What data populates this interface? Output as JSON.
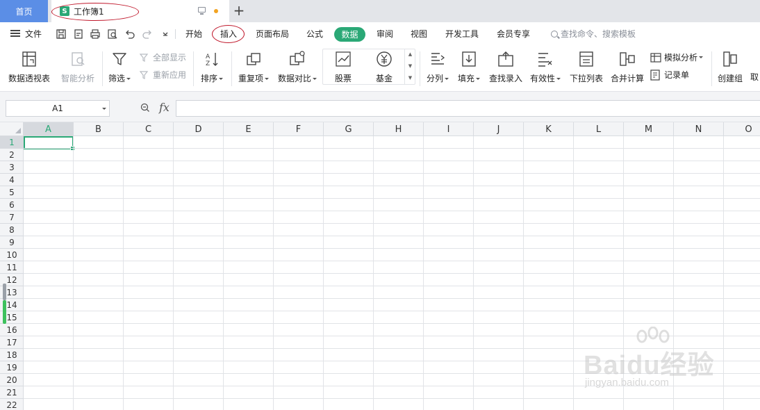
{
  "tabs": {
    "home": "首页",
    "doc_icon": "S",
    "doc_title": "工作簿1",
    "add": "+"
  },
  "menu": {
    "file": "文件",
    "items": [
      "开始",
      "插入",
      "页面布局",
      "公式",
      "数据",
      "审阅",
      "视图",
      "开发工具",
      "会员专享"
    ],
    "active": "数据",
    "search_placeholder": "查找命令、搜索模板"
  },
  "ribbon": {
    "pivot": "数据透视表",
    "smart": "智能分析",
    "filter": "筛选",
    "show_all": "全部显示",
    "reapply": "重新应用",
    "sort": "排序",
    "duplicates": "重复项",
    "compare": "数据对比",
    "stock": "股票",
    "fund": "基金",
    "split": "分列",
    "fill": "填充",
    "lookup": "查找录入",
    "validity": "有效性",
    "dropdown": "下拉列表",
    "consolidate": "合并计算",
    "whatif": "模拟分析",
    "record": "记录单",
    "group": "创建组",
    "ungroup": "取"
  },
  "formula_bar": {
    "name_box": "A1",
    "fx": "fx",
    "value": ""
  },
  "grid": {
    "columns": [
      "A",
      "B",
      "C",
      "D",
      "E",
      "F",
      "G",
      "H",
      "I",
      "J",
      "K",
      "L",
      "M",
      "N",
      "O"
    ],
    "rows": [
      "1",
      "2",
      "3",
      "4",
      "5",
      "6",
      "7",
      "8",
      "9",
      "10",
      "11",
      "12",
      "13",
      "14",
      "15",
      "16",
      "17",
      "18",
      "19",
      "20",
      "21",
      "22"
    ],
    "active_cell": "A1"
  },
  "watermark": {
    "brand": "Baidu经验",
    "url": "jingyan.baidu.com"
  },
  "colors": {
    "accent_green": "#2aa876",
    "home_tab_blue": "#5b8ee6",
    "annotation_red": "#c0182b"
  }
}
